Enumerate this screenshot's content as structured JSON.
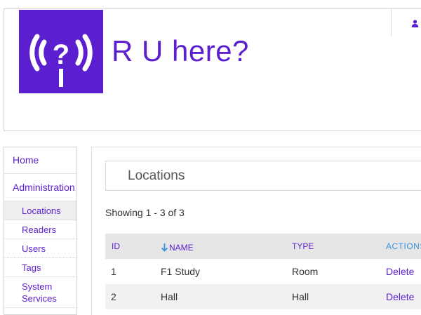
{
  "header": {
    "app_title": "R U here?",
    "logo_icon": "wifi-question-icon",
    "user_icon": "user-icon",
    "brand_color": "#5b1fcf"
  },
  "sidebar": {
    "items": [
      {
        "label": "Home"
      },
      {
        "label": "Administration"
      }
    ],
    "sub_items": [
      {
        "label": "Locations",
        "active": true
      },
      {
        "label": "Readers",
        "active": false
      },
      {
        "label": "Users",
        "active": false
      },
      {
        "label": "Tags",
        "active": false
      },
      {
        "label": "System Services",
        "active": false
      }
    ]
  },
  "main": {
    "title": "Locations",
    "showing_text": "Showing 1 - 3 of 3",
    "table": {
      "columns": [
        "ID",
        "NAME",
        "TYPE",
        "ACTIONS"
      ],
      "sorted_column": "NAME",
      "rows": [
        {
          "id": "1",
          "name": "F1 Study",
          "type": "Room",
          "action": "Delete"
        },
        {
          "id": "2",
          "name": "Hall",
          "type": "Hall",
          "action": "Delete"
        }
      ]
    }
  }
}
